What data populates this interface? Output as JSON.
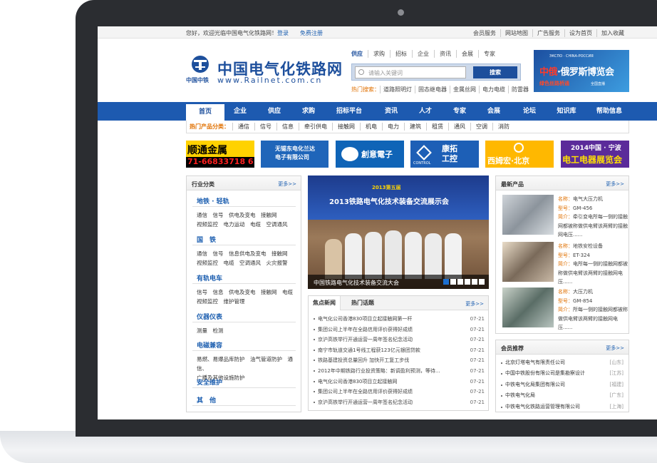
{
  "topbar": {
    "welcome": "您好，欢迎光临中国电气化铁路网！",
    "login": "登录",
    "register": "免费注册",
    "links": [
      "会员服务",
      "网站地图",
      "广告服务",
      "设为首页",
      "加入收藏"
    ]
  },
  "logo": {
    "title": "中国电气化铁路网",
    "url": "www.Railnet.com.cn",
    "sub": "中国中铁"
  },
  "search": {
    "tabs": [
      "供应",
      "求购",
      "招标",
      "企业",
      "资讯",
      "会展",
      "专家"
    ],
    "placeholder": "请输入关键词",
    "button": "搜索",
    "hot_label": "热门搜索：",
    "hot_items": [
      "道路照明灯",
      "固态继电器",
      "金属丝网",
      "电力电缆",
      "防雷器"
    ]
  },
  "ad_expo": {
    "top": "ЭКСПО · CHINA-РОССИЯ",
    "big_a": "中俄",
    "big_b": "·俄罗斯博览会",
    "sub": "绿色丝路桥通",
    "sub2": "全国直播"
  },
  "nav": {
    "items": [
      "首页",
      "企业",
      "供应",
      "求购",
      "招标平台",
      "资讯",
      "人才",
      "专家",
      "会展",
      "论坛",
      "知识库",
      "帮助信息"
    ]
  },
  "hot_products": {
    "label": "热门产品分类：",
    "items": [
      "通信",
      "信号",
      "信息",
      "牵引供电",
      "接触网",
      "机电",
      "电力",
      "建筑",
      "租赁",
      "通风",
      "空调",
      "消防"
    ]
  },
  "banners": {
    "b1_title": "顺通金属",
    "b1_phone": "71-66833718  6",
    "b2_title_1": "无锡东电化兰达",
    "b2_title_2": "电子有限公司",
    "b3_title": "創意電子",
    "b4_title_1": "康拓",
    "b4_title_2": "工控",
    "b4_sub": "CONTROL",
    "b5_title": "西姆宏·北京",
    "b6_title_1": "2014中国 · 宁波",
    "b6_title_2": "电工电器展览会"
  },
  "industry": {
    "title": "行业分类",
    "more": "更多>>",
    "groups": [
      {
        "name": "地铁 · 轻轨",
        "lines": [
          "通信　信号　供电及变电　接触网",
          "视频监控　电力运动　电缆　空调通风"
        ]
      },
      {
        "name": "国　铁",
        "lines": [
          "通信　信号　信息供电及变电　接触网",
          "视频监控　电缆　空调通风　火灾报警"
        ]
      },
      {
        "name": "有轨电车",
        "lines": [
          "信号　信息　供电及变电　接触网　电缆",
          "视频监控　维护管理"
        ]
      },
      {
        "name": "仪器仪表",
        "lines": [
          "测量　检测"
        ]
      },
      {
        "name": "电磁兼容",
        "lines": [
          "易燃、易爆品库防护　油气管道防护　通信、",
          "广播及其他设施防护"
        ]
      },
      {
        "name": "安全维护",
        "lines": []
      },
      {
        "name": "其　他",
        "lines": []
      }
    ]
  },
  "slide": {
    "heading_1": "2013第五届",
    "heading_2": "2013铁路电气化技术装备交流展示会",
    "caption": "中国铁路电气化技术装备交流大会"
  },
  "news": {
    "tab_focus": "焦点新闻",
    "tab_hot": "热门话题",
    "more": "更多>>",
    "items": [
      {
        "title": "电气化公司香港830项目立起接触网第一杆",
        "date": "07-21"
      },
      {
        "title": "集团公司上半年在全路信用评价获得好成绩",
        "date": "07-21"
      },
      {
        "title": "京沪高铁举行开通运营一周年签名纪念活动",
        "date": "07-21"
      },
      {
        "title": "南宁市轨道交通1号线工程获123亿元银团贷款",
        "date": "07-21"
      },
      {
        "title": "铁路基建投资总量回升 加快开工复工步伐",
        "date": "07-21"
      },
      {
        "title": "2012年中期铁路行业投资策略：新调盈利预测，等待...",
        "date": "07-21"
      },
      {
        "title": "电气化公司香港830项目立起接触网",
        "date": "07-21"
      },
      {
        "title": "集团公司上半年在全路信用评价获得好成绩",
        "date": "07-21"
      },
      {
        "title": "京沪高铁举行开通运营一周年签名纪念活动",
        "date": "07-21"
      }
    ]
  },
  "new_products": {
    "title": "最新产品",
    "more": "更多>>",
    "items": [
      {
        "name_k": "名称：",
        "name": "电气大压力机",
        "model_k": "型号：",
        "model": "GM-456",
        "desc_k": "简介：",
        "desc": "牵引变电所每一侧的接触网都被称做供电臂该两臂的接触网电压......"
      },
      {
        "name_k": "名称：",
        "name": "地铁安检设备",
        "model_k": "型号：",
        "model": "ET-324",
        "desc_k": "简介：",
        "desc": "电所每一侧的接触网都被称做供电臂该两臂的接触网电压......"
      },
      {
        "name_k": "名称：",
        "name": "大压力机",
        "model_k": "型号：",
        "model": "GM-854",
        "desc_k": "简介：",
        "desc": "所每一侧的接触网都被称做供电臂该两臂的接触网电压......"
      }
    ]
  },
  "members": {
    "title": "会员推荐",
    "more": "更多>>",
    "items": [
      {
        "name": "北京灯塔电气有限责任公司",
        "region": "[山东]"
      },
      {
        "name": "中国中铁股份有限公司是集勘察设计",
        "region": "[江苏]"
      },
      {
        "name": "中铁电气化局集团有限公司",
        "region": "[福建]"
      },
      {
        "name": "中铁电气化局",
        "region": "[广东]"
      },
      {
        "name": "中铁电气化铁路运营管理有限公司",
        "region": "[上海]"
      }
    ]
  },
  "colors": {
    "brand_blue": "#1d5ab0",
    "accent_orange": "#e07000"
  }
}
